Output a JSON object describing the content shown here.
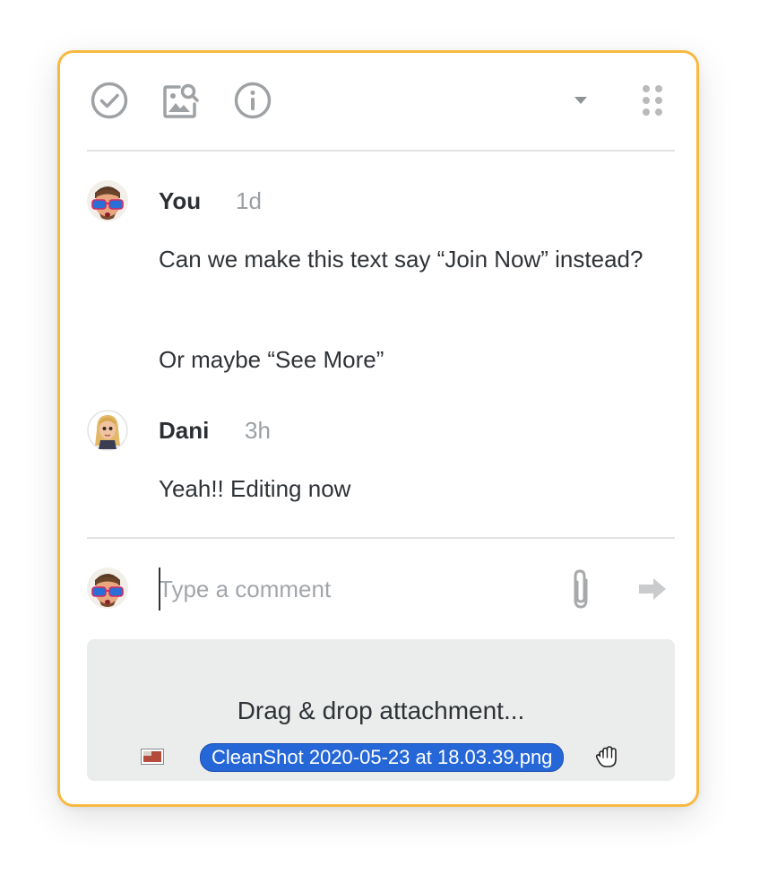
{
  "toolbar": {
    "icons": [
      "check-circle-icon",
      "image-search-icon",
      "info-icon",
      "caret-down-icon",
      "drag-handle-icon"
    ]
  },
  "comments": [
    {
      "author": "You",
      "time": "1d",
      "avatar": "avatar-you",
      "paragraphs": [
        "Can we make this text say “Join Now” instead?",
        "Or maybe “See More”"
      ]
    },
    {
      "author": "Dani",
      "time": "3h",
      "avatar": "avatar-dani",
      "paragraphs": [
        "Yeah!! Editing now"
      ]
    }
  ],
  "compose": {
    "placeholder": "Type a comment",
    "value": "",
    "attach_icon": "paperclip-icon",
    "send_icon": "send-arrow-icon"
  },
  "dropzone": {
    "label": "Drag & drop attachment...",
    "dragged_file": "CleanShot 2020-05-23 at 18.03.39.png"
  },
  "colors": {
    "card_border": "#f8b940",
    "icon_gray": "#a7a9ab",
    "file_pill": "#2667d8",
    "dropzone_bg": "#ebecec"
  }
}
